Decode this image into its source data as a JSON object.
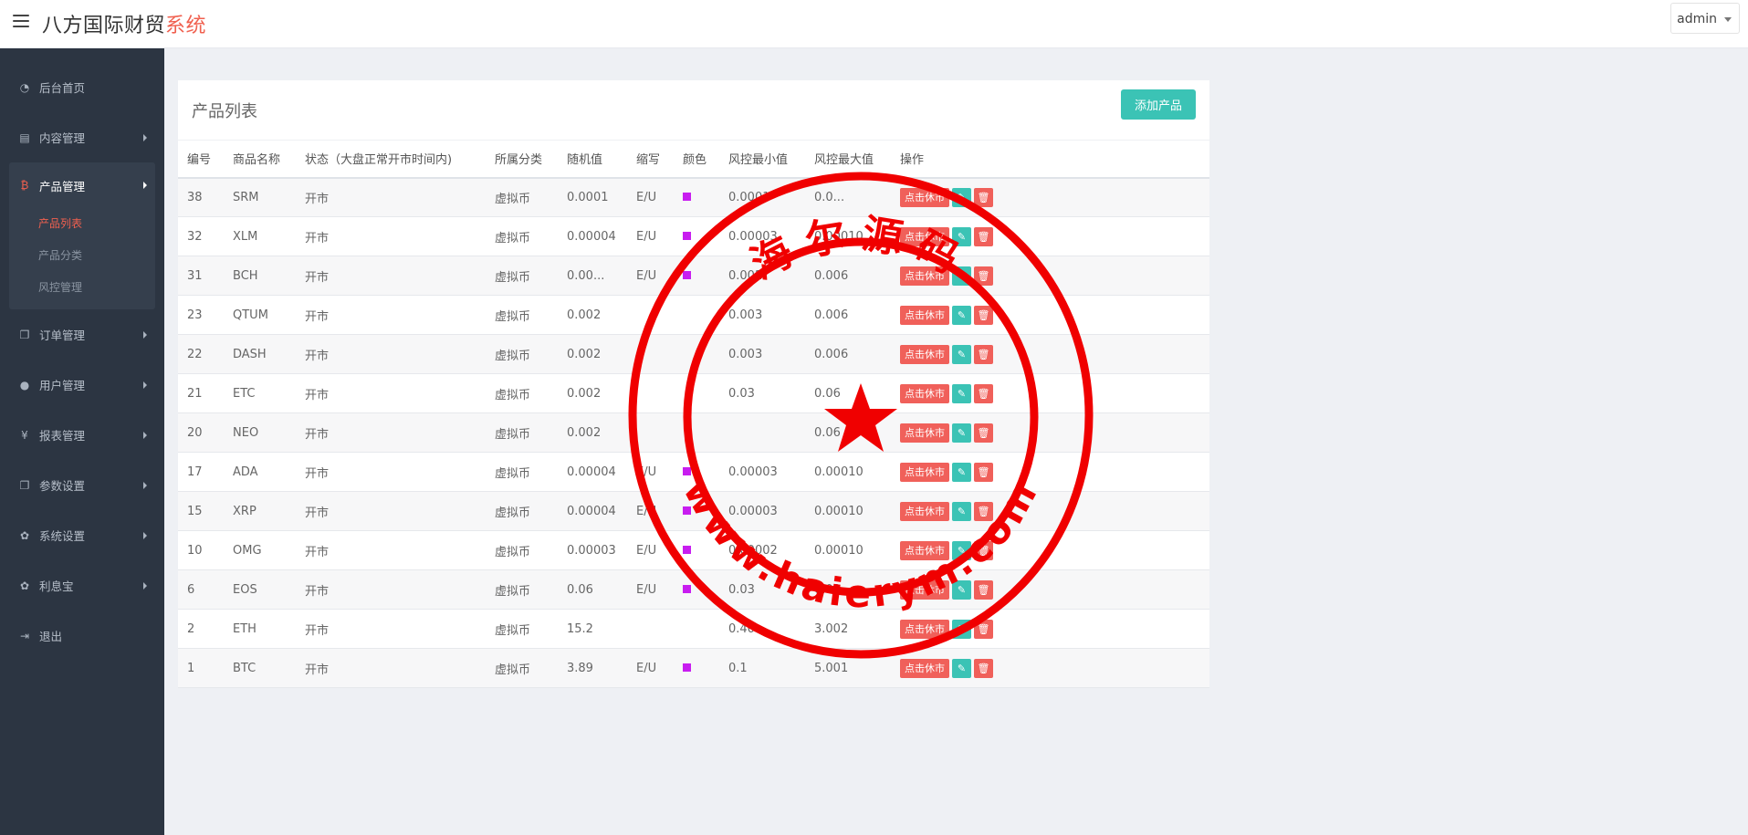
{
  "header": {
    "brand_main": "八方国际财贸",
    "brand_accent": "系统",
    "user": "admin"
  },
  "sidebar": {
    "items": [
      {
        "label": "后台首页",
        "icon": "dashboard-icon",
        "glyph": "◔",
        "caret": false
      },
      {
        "label": "内容管理",
        "icon": "book-icon",
        "glyph": "▤",
        "caret": true
      }
    ],
    "active_group": {
      "label": "产品管理",
      "icon": "bitcoin-icon",
      "glyph": "₿",
      "children": [
        {
          "label": "产品列表",
          "active": true
        },
        {
          "label": "产品分类",
          "active": false
        },
        {
          "label": "风控管理",
          "active": false
        }
      ]
    },
    "items_after": [
      {
        "label": "订单管理",
        "icon": "copy-icon",
        "glyph": "❐",
        "caret": true
      },
      {
        "label": "用户管理",
        "icon": "user-icon",
        "glyph": "●",
        "caret": true
      },
      {
        "label": "报表管理",
        "icon": "yen-icon",
        "glyph": "¥",
        "caret": true
      },
      {
        "label": "参数设置",
        "icon": "copy-icon",
        "glyph": "❐",
        "caret": true
      },
      {
        "label": "系统设置",
        "icon": "gears-icon",
        "glyph": "✿",
        "caret": true
      },
      {
        "label": "利息宝",
        "icon": "gears-icon",
        "glyph": "✿",
        "caret": true
      },
      {
        "label": "退出",
        "icon": "sign-out-icon",
        "glyph": "⇥",
        "caret": false
      }
    ]
  },
  "panel": {
    "title": "产品列表",
    "add_button": "添加产品"
  },
  "table": {
    "columns": [
      "编号",
      "商品名称",
      "状态（大盘正常开市时间内)",
      "所属分类",
      "随机值",
      "缩写",
      "颜色",
      "风控最小值",
      "风控最大值",
      "操作"
    ],
    "halt_label": "点击休市",
    "swatch_color": "#c81df0",
    "rows": [
      {
        "id": "38",
        "name": "SRM",
        "status": "开市",
        "category": "虚拟币",
        "random": "0.0001",
        "abbr": "E/U",
        "color": true,
        "min": "0.0001",
        "max": "0.0..."
      },
      {
        "id": "32",
        "name": "XLM",
        "status": "开市",
        "category": "虚拟币",
        "random": "0.00004",
        "abbr": "E/U",
        "color": true,
        "min": "0.00003",
        "max": "0.00010"
      },
      {
        "id": "31",
        "name": "BCH",
        "status": "开市",
        "category": "虚拟币",
        "random": "0.00...",
        "abbr": "E/U",
        "color": true,
        "min": "0.002",
        "max": "0.006"
      },
      {
        "id": "23",
        "name": "QTUM",
        "status": "开市",
        "category": "虚拟币",
        "random": "0.002",
        "abbr": "",
        "color": false,
        "min": "0.003",
        "max": "0.006"
      },
      {
        "id": "22",
        "name": "DASH",
        "status": "开市",
        "category": "虚拟币",
        "random": "0.002",
        "abbr": "",
        "color": false,
        "min": "0.003",
        "max": "0.006"
      },
      {
        "id": "21",
        "name": "ETC",
        "status": "开市",
        "category": "虚拟币",
        "random": "0.002",
        "abbr": "",
        "color": false,
        "min": "0.03",
        "max": "0.06"
      },
      {
        "id": "20",
        "name": "NEO",
        "status": "开市",
        "category": "虚拟币",
        "random": "0.002",
        "abbr": "",
        "color": false,
        "min": "",
        "max": "0.06"
      },
      {
        "id": "17",
        "name": "ADA",
        "status": "开市",
        "category": "虚拟币",
        "random": "0.00004",
        "abbr": "E/U",
        "color": true,
        "min": "0.00003",
        "max": "0.00010"
      },
      {
        "id": "15",
        "name": "XRP",
        "status": "开市",
        "category": "虚拟币",
        "random": "0.00004",
        "abbr": "E/U",
        "color": true,
        "min": "0.00003",
        "max": "0.00010"
      },
      {
        "id": "10",
        "name": "OMG",
        "status": "开市",
        "category": "虚拟币",
        "random": "0.00003",
        "abbr": "E/U",
        "color": true,
        "min": "0.00002",
        "max": "0.00010"
      },
      {
        "id": "6",
        "name": "EOS",
        "status": "开市",
        "category": "虚拟币",
        "random": "0.06",
        "abbr": "E/U",
        "color": true,
        "min": "0.03",
        "max": "0.01"
      },
      {
        "id": "2",
        "name": "ETH",
        "status": "开市",
        "category": "虚拟币",
        "random": "15.2",
        "abbr": "",
        "color": false,
        "min": "0.40",
        "max": "3.002"
      },
      {
        "id": "1",
        "name": "BTC",
        "status": "开市",
        "category": "虚拟币",
        "random": "3.89",
        "abbr": "E/U",
        "color": true,
        "min": "0.1",
        "max": "5.001"
      }
    ]
  },
  "stamp": {
    "top_text": "海尔源码",
    "bottom_text": "www.haierym.com",
    "color": "#f00000"
  }
}
